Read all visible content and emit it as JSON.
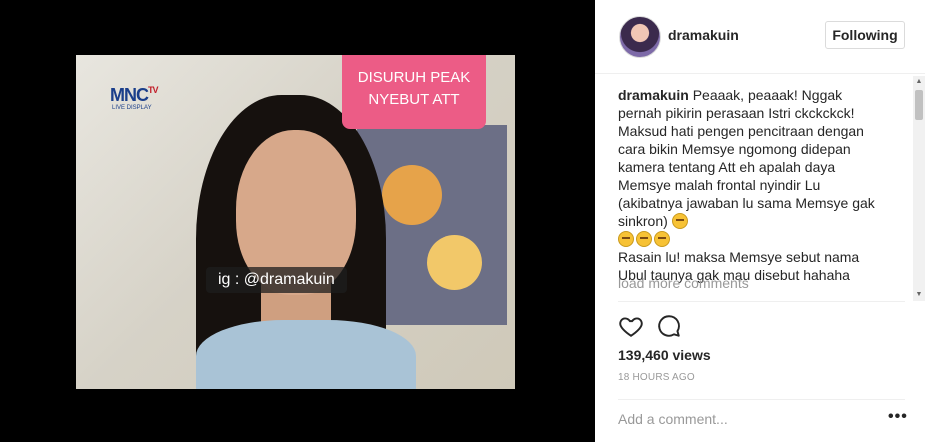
{
  "media": {
    "channel_logo": "MNC",
    "channel_logo_suffix": "TV",
    "channel_sub": "LIVE DISPLAY",
    "caption_line1": "DISURUH PEAK",
    "caption_line2": "NYEBUT ATT",
    "ig_tag": "ig : @dramakuin"
  },
  "header": {
    "username": "dramakuin",
    "follow_label": "Following"
  },
  "comment": {
    "username": "dramakuin",
    "text1": "Peaaak, peaaak! Nggak pernah pikirin perasaan Istri ckckckck!",
    "text2": "Maksud hati pengen pencitraan dengan cara bikin Memsye ngomong didepan kamera tentang Att eh apalah daya Memsye malah frontal nyindir Lu (akibatnya jawaban lu sama Memsye gak sinkron)",
    "text3": "Rasain lu! maksa Memsye sebut nama Ubul taunya gak mau disebut hahaha"
  },
  "load_more": "load more comments",
  "stats": {
    "views": "139,460 views",
    "time": "18 HOURS AGO"
  },
  "comment_box": {
    "placeholder": "Add a comment...",
    "more": "•••"
  },
  "icons": {
    "like": "heart-icon",
    "comment": "speech-bubble-icon",
    "emoji": "crying-laughing-emoji"
  },
  "colors": {
    "caption_bg": "#ec5c86",
    "text": "#262626",
    "muted": "#999999"
  }
}
